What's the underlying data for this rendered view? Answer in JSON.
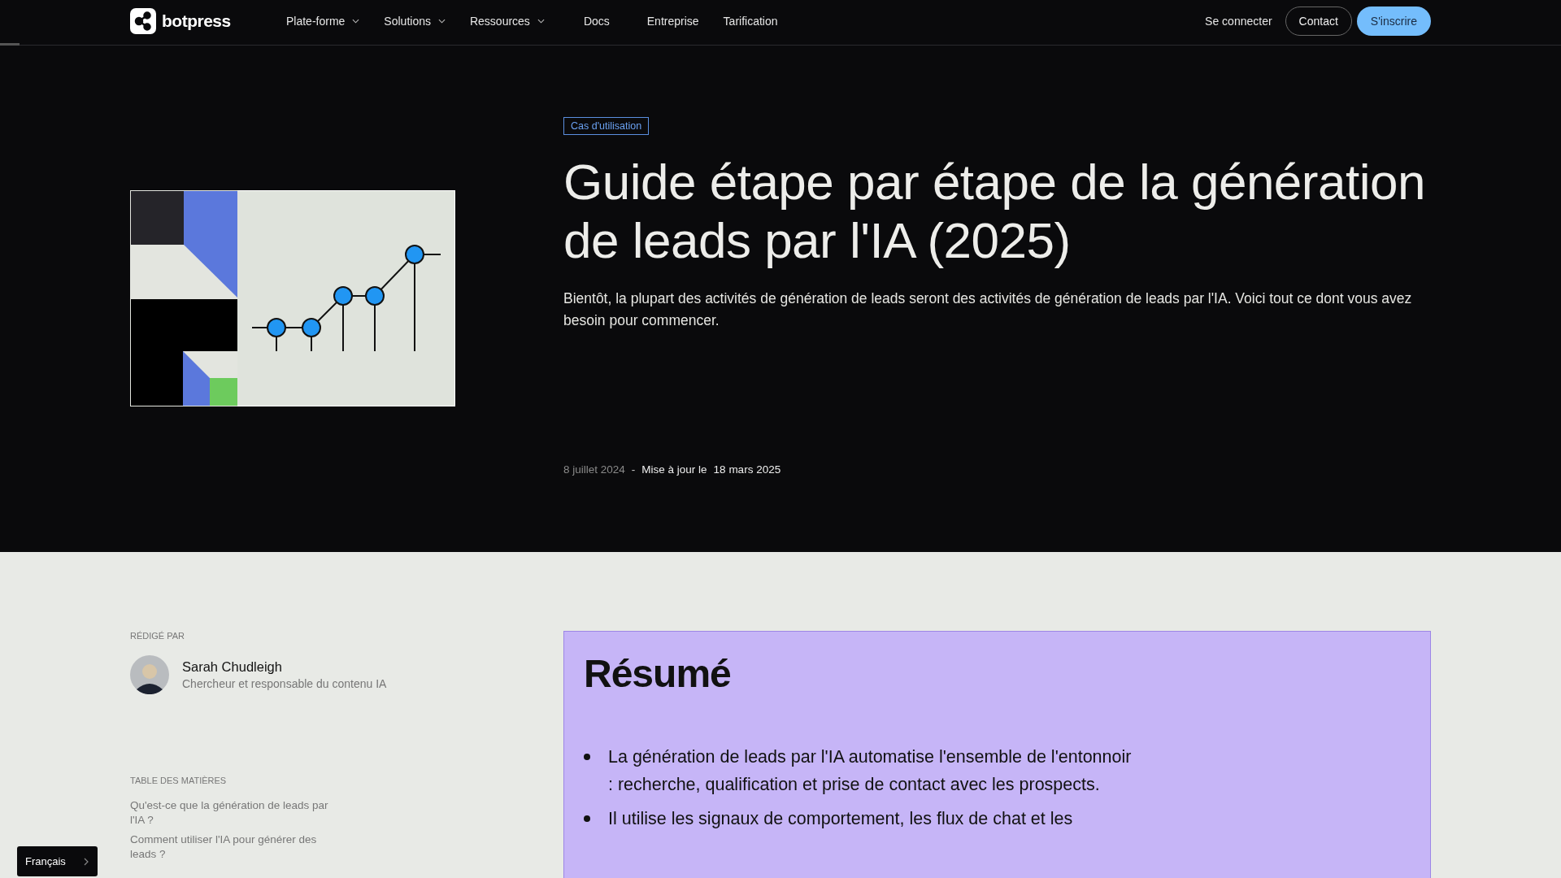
{
  "nav": {
    "brand": "botpress",
    "items": [
      {
        "label": "Plate-forme",
        "has_menu": true
      },
      {
        "label": "Solutions",
        "has_menu": true
      },
      {
        "label": "Ressources",
        "has_menu": true
      },
      {
        "label": "Docs",
        "has_menu": false
      },
      {
        "label": "Entreprise",
        "has_menu": false
      },
      {
        "label": "Tarification",
        "has_menu": false
      }
    ],
    "login": "Se connecter",
    "contact": "Contact",
    "signup": "S'inscrire"
  },
  "reading_progress": {
    "level": 0.0125
  },
  "hero": {
    "tag": "Cas d'utilisation",
    "title": "Guide étape par étape de la génération de leads par l'IA (2025)",
    "description": "Bientôt, la plupart des activités de génération de leads seront des activités de génération de leads par l'IA. Voici tout ce dont vous avez besoin pour commencer.",
    "published": "8 juillet 2024",
    "separator": "-",
    "updated_label": "Mise à jour le",
    "updated": "18 mars 2025"
  },
  "author": {
    "label": "RÉDIGÉ PAR",
    "name": "Sarah Chudleigh",
    "role": "Chercheur et responsable du contenu IA"
  },
  "toc": {
    "title": "TABLE DES MATIÈRES",
    "items": [
      "Qu'est-ce que la génération de leads par l'IA ?",
      "Comment utiliser l'IA pour générer des leads ?"
    ]
  },
  "summary": {
    "title": "Résumé",
    "bullets": [
      "La génération de leads par l'IA automatise l'ensemble de l'entonnoir : recherche, qualification et prise de contact avec les prospects.",
      "Il utilise les signaux de comportement, les flux de chat et les"
    ]
  },
  "language": {
    "label": "Français"
  }
}
